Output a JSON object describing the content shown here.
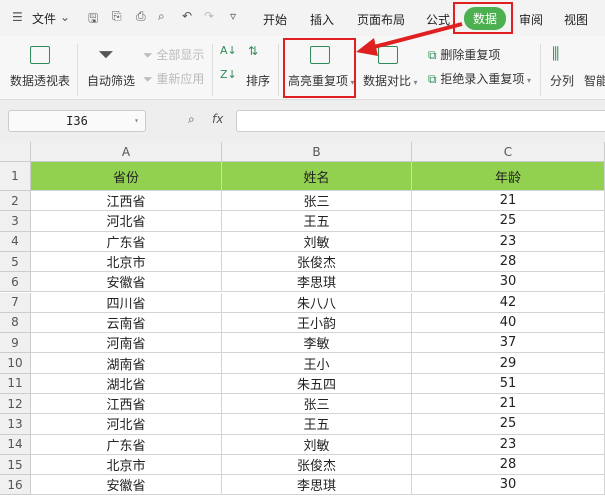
{
  "toolbar": {
    "file": "文件",
    "tabs": [
      "开始",
      "插入",
      "页面布局",
      "公式",
      "数据",
      "审阅",
      "视图"
    ],
    "active_tab": "数据"
  },
  "ribbon": {
    "pivot": "数据透视表",
    "autofilter": "自动筛选",
    "show_all": "全部显示",
    "reapply": "重新应用",
    "sort": "排序",
    "highlight_dup": "高亮重复项",
    "compare": "数据对比",
    "delete_dup": "删除重复项",
    "reject_dup": "拒绝录入重复项",
    "split": "分列",
    "smart": "智能"
  },
  "formula_bar": {
    "cell_ref": "I36",
    "fx": "fx",
    "value": ""
  },
  "colors": {
    "accent": "#4caf50",
    "header_fill": "#92d050",
    "highlight": "#e02020"
  },
  "sheet": {
    "columns": [
      "A",
      "B",
      "C"
    ],
    "header": {
      "row": "1",
      "cells": [
        "省份",
        "姓名",
        "年龄"
      ]
    },
    "rows": [
      {
        "n": "2",
        "cells": [
          "江西省",
          "张三",
          "21"
        ]
      },
      {
        "n": "3",
        "cells": [
          "河北省",
          "王五",
          "25"
        ]
      },
      {
        "n": "4",
        "cells": [
          "广东省",
          "刘敏",
          "23"
        ]
      },
      {
        "n": "5",
        "cells": [
          "北京市",
          "张俊杰",
          "28"
        ]
      },
      {
        "n": "6",
        "cells": [
          "安徽省",
          "李思琪",
          "30"
        ]
      },
      {
        "n": "7",
        "cells": [
          "四川省",
          "朱八八",
          "42"
        ]
      },
      {
        "n": "8",
        "cells": [
          "云南省",
          "王小韵",
          "40"
        ]
      },
      {
        "n": "9",
        "cells": [
          "河南省",
          "李敏",
          "37"
        ]
      },
      {
        "n": "10",
        "cells": [
          "湖南省",
          "王小",
          "29"
        ]
      },
      {
        "n": "11",
        "cells": [
          "湖北省",
          "朱五四",
          "51"
        ]
      },
      {
        "n": "12",
        "cells": [
          "江西省",
          "张三",
          "21"
        ]
      },
      {
        "n": "13",
        "cells": [
          "河北省",
          "王五",
          "25"
        ]
      },
      {
        "n": "14",
        "cells": [
          "广东省",
          "刘敏",
          "23"
        ]
      },
      {
        "n": "15",
        "cells": [
          "北京市",
          "张俊杰",
          "28"
        ]
      },
      {
        "n": "16",
        "cells": [
          "安徽省",
          "李思琪",
          "30"
        ]
      }
    ]
  }
}
